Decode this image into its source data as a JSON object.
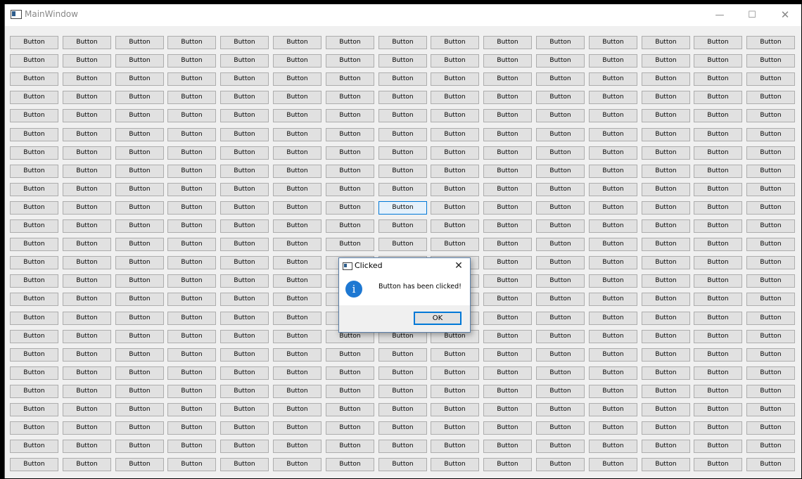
{
  "window": {
    "title": "MainWindow",
    "minimize_glyph": "—",
    "maximize_glyph": "☐",
    "close_glyph": "✕"
  },
  "grid": {
    "rows": 24,
    "columns": 15,
    "button_label": "Button",
    "focused_button": {
      "row": 10,
      "column": 8
    }
  },
  "dialog": {
    "title": "Clicked",
    "close_glyph": "✕",
    "icon": "information-icon",
    "icon_glyph": "i",
    "message": "Button has been clicked!",
    "ok_label": "OK"
  },
  "colors": {
    "focus_border": "#0078d7",
    "info_icon": "#1e78d2"
  }
}
